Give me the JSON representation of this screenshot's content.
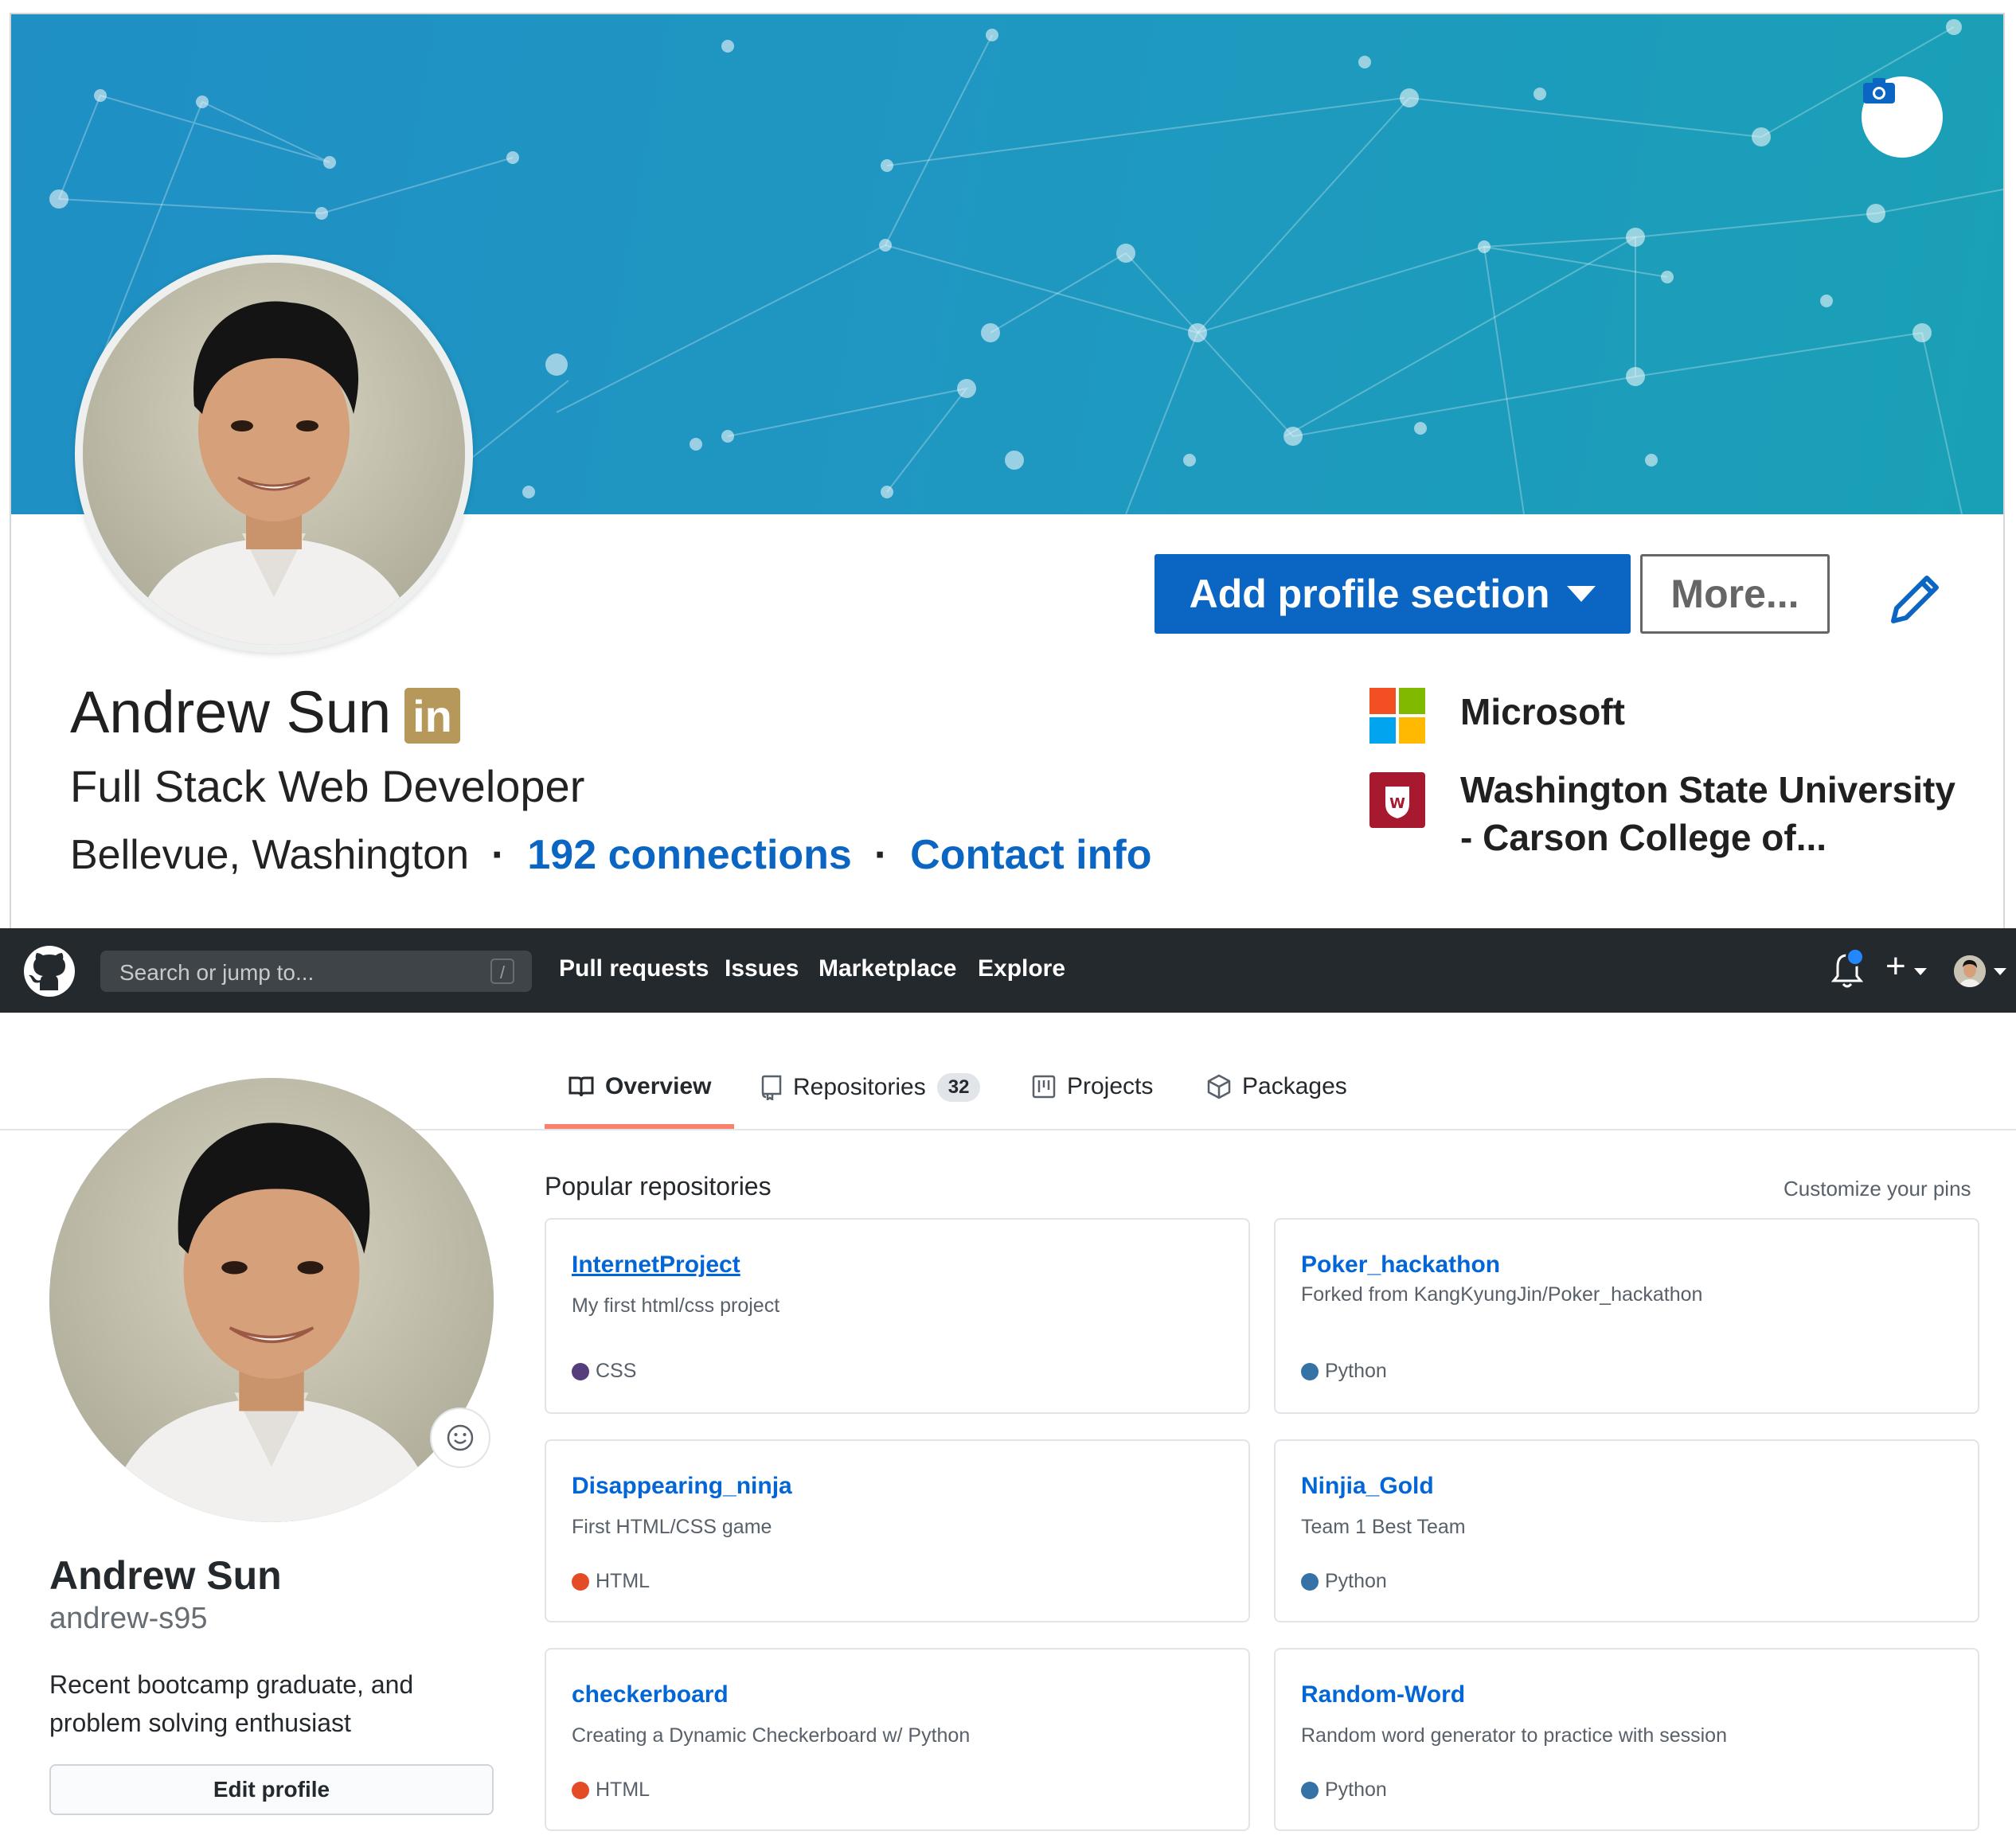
{
  "linkedin": {
    "name": "Andrew Sun",
    "badge": "in",
    "headline": "Full Stack Web Developer",
    "location": "Bellevue, Washington",
    "separator": "·",
    "connections": "192 connections",
    "contact": "Contact info",
    "add_section_label": "Add profile section",
    "more_label": "More...",
    "orgs": [
      {
        "name": "Microsoft"
      },
      {
        "name": "Washington State University - Carson College of..."
      }
    ],
    "colors": {
      "banner": "#1f97c2",
      "primary": "#0a66c2",
      "badge": "#b5985a"
    }
  },
  "github": {
    "search_placeholder": "Search or jump to...",
    "search_shortcut": "/",
    "nav": [
      "Pull requests",
      "Issues",
      "Marketplace",
      "Explore"
    ],
    "plus": "+",
    "tabs": [
      {
        "label": "Overview",
        "icon": "book-icon"
      },
      {
        "label": "Repositories",
        "icon": "repo-icon",
        "count": "32"
      },
      {
        "label": "Projects",
        "icon": "project-icon"
      },
      {
        "label": "Packages",
        "icon": "package-icon"
      }
    ],
    "profile": {
      "name": "Andrew Sun",
      "login": "andrew-s95",
      "bio": "Recent bootcamp graduate, and problem solving enthusiast",
      "edit_label": "Edit profile"
    },
    "popular_title": "Popular repositories",
    "customize_label": "Customize your pins",
    "repos": [
      {
        "name": "InternetProject",
        "desc": "My first html/css project",
        "lang": "CSS",
        "lang_color": "#563d7c"
      },
      {
        "name": "Poker_hackathon",
        "desc": "Forked from KangKyungJin/Poker_hackathon",
        "lang": "Python",
        "lang_color": "#3572A5"
      },
      {
        "name": "Disappearing_ninja",
        "desc": "First HTML/CSS game",
        "lang": "HTML",
        "lang_color": "#e34c26"
      },
      {
        "name": "Ninjia_Gold",
        "desc": "Team 1 Best Team",
        "lang": "Python",
        "lang_color": "#3572A5"
      },
      {
        "name": "checkerboard",
        "desc": "Creating a Dynamic Checkerboard w/ Python",
        "lang": "HTML",
        "lang_color": "#e34c26"
      },
      {
        "name": "Random-Word",
        "desc": "Random word generator to practice with session",
        "lang": "Python",
        "lang_color": "#3572A5"
      }
    ],
    "colors": {
      "header": "#24292e",
      "link": "#0366d6",
      "tab_active": "#f9826c"
    }
  }
}
